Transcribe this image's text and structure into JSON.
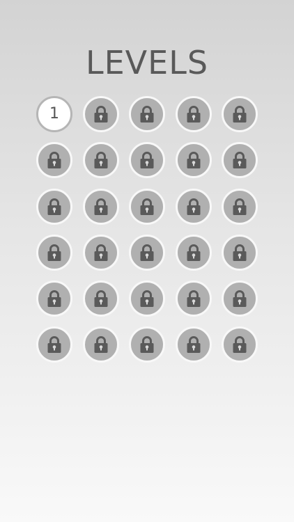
{
  "screen": {
    "title": "LEVELS",
    "background_top": "#d3d3d3",
    "background_bottom": "#f9f9f9"
  },
  "levels": [
    {
      "number": "1",
      "locked": false
    },
    {
      "number": "",
      "locked": true,
      "icon": "lock-icon"
    },
    {
      "number": "",
      "locked": true,
      "icon": "lock-icon"
    },
    {
      "number": "",
      "locked": true,
      "icon": "lock-icon"
    },
    {
      "number": "",
      "locked": true,
      "icon": "lock-icon"
    },
    {
      "number": "",
      "locked": true,
      "icon": "lock-icon"
    },
    {
      "number": "",
      "locked": true,
      "icon": "lock-icon"
    },
    {
      "number": "",
      "locked": true,
      "icon": "lock-icon"
    },
    {
      "number": "",
      "locked": true,
      "icon": "lock-icon"
    },
    {
      "number": "",
      "locked": true,
      "icon": "lock-icon"
    },
    {
      "number": "",
      "locked": true,
      "icon": "lock-icon"
    },
    {
      "number": "",
      "locked": true,
      "icon": "lock-icon"
    },
    {
      "number": "",
      "locked": true,
      "icon": "lock-icon"
    },
    {
      "number": "",
      "locked": true,
      "icon": "lock-icon"
    },
    {
      "number": "",
      "locked": true,
      "icon": "lock-icon"
    },
    {
      "number": "",
      "locked": true,
      "icon": "lock-icon"
    },
    {
      "number": "",
      "locked": true,
      "icon": "lock-icon"
    },
    {
      "number": "",
      "locked": true,
      "icon": "lock-icon"
    },
    {
      "number": "",
      "locked": true,
      "icon": "lock-icon"
    },
    {
      "number": "",
      "locked": true,
      "icon": "lock-icon"
    },
    {
      "number": "",
      "locked": true,
      "icon": "lock-icon"
    },
    {
      "number": "",
      "locked": true,
      "icon": "lock-icon"
    },
    {
      "number": "",
      "locked": true,
      "icon": "lock-icon"
    },
    {
      "number": "",
      "locked": true,
      "icon": "lock-icon"
    },
    {
      "number": "",
      "locked": true,
      "icon": "lock-icon"
    },
    {
      "number": "",
      "locked": true,
      "icon": "lock-icon"
    },
    {
      "number": "",
      "locked": true,
      "icon": "lock-icon"
    },
    {
      "number": "",
      "locked": true,
      "icon": "lock-icon"
    },
    {
      "number": "",
      "locked": true,
      "icon": "lock-icon"
    },
    {
      "number": "",
      "locked": true,
      "icon": "lock-icon"
    }
  ],
  "colors": {
    "title": "#595959",
    "locked_fill": "#b0b0b0",
    "locked_ring": "#f8f8f8",
    "unlocked_fill": "#ffffff",
    "unlocked_ring": "#b5b5b5",
    "lock_glyph": "#5a5a5a"
  }
}
